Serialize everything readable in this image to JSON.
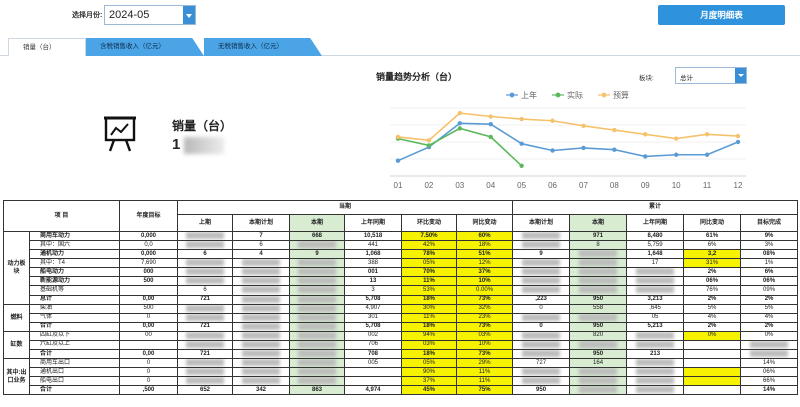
{
  "header": {
    "month_label": "选择月份:",
    "month_value": "2024-05",
    "detail_button": "月度明细表"
  },
  "tabs": [
    "销量（台）",
    "含税销售收入（亿元）",
    "无税销售收入（亿元）"
  ],
  "kpi": {
    "label": "销量（台）",
    "value": "1"
  },
  "chart_header": {
    "title": "销量趋势分析（台）",
    "board_label": "板块:",
    "board_value": "总计"
  },
  "chart_data": {
    "type": "line",
    "categories": [
      "01",
      "02",
      "03",
      "04",
      "05",
      "06",
      "07",
      "08",
      "09",
      "10",
      "11",
      "12"
    ],
    "series": [
      {
        "name": "上年",
        "color": "#5b9bd5",
        "values": [
          5.8,
          7.4,
          10.2,
          10.1,
          7.8,
          7.0,
          7.3,
          7.1,
          6.3,
          6.5,
          6.5,
          8.0
        ]
      },
      {
        "name": "实际",
        "color": "#5cb85c",
        "values": [
          8.4,
          7.6,
          9.6,
          8.6,
          5.2,
          null,
          null,
          null,
          null,
          null,
          null,
          null
        ]
      },
      {
        "name": "预算",
        "color": "#f5c26b",
        "values": [
          8.6,
          8.2,
          11.4,
          11.0,
          10.7,
          10.5,
          9.9,
          9.4,
          8.9,
          8.4,
          8.9,
          8.7
        ]
      }
    ],
    "xlabel": "",
    "ylabel": "",
    "legend_position": "top-center",
    "grid": "horizontal"
  },
  "table": {
    "headers": {
      "item": "项   目",
      "annual_target": "年度目标",
      "current_group": "当期",
      "cumulative_group": "累计",
      "cols": [
        "上期",
        "本期计划",
        "本期",
        "上年同期",
        "环比变动",
        "同比变动",
        "本期计划",
        "本期",
        "上年同期",
        "同比变动",
        "目标完成"
      ]
    },
    "categories": [
      "动力板块",
      "燃料",
      "缸数",
      "其中:出口业务"
    ],
    "rows": [
      {
        "name": "商用车动力",
        "target": "0,000",
        "c": [
          "",
          "7",
          "668",
          "10,518",
          "7.50%",
          "60%",
          "",
          "971",
          "8,480",
          "61%",
          "9%"
        ]
      },
      {
        "name": "其中：国六",
        "target": "0,0",
        "c": [
          "",
          "6",
          "",
          "441",
          "42%",
          "18%",
          "",
          "8",
          "5,759",
          "6%",
          "3%"
        ]
      },
      {
        "name": "通机动力",
        "target": "0,000",
        "c": [
          "6",
          "4",
          "9",
          "1,068",
          "78%",
          "51%",
          "9",
          "",
          "1,648",
          "3,2",
          "08%"
        ]
      },
      {
        "name": "其中：T4",
        "target": "7,690",
        "c": [
          "",
          "",
          "",
          "388",
          "05%",
          "12%",
          "",
          "",
          "17",
          "31%",
          "1%"
        ]
      },
      {
        "name": "船电动力",
        "target": "000",
        "c": [
          "",
          "",
          "",
          "001",
          "70%",
          "37%",
          "",
          "",
          "",
          "2%",
          "6%"
        ]
      },
      {
        "name": "新能源动力",
        "target": "500",
        "c": [
          "",
          "",
          "",
          "13",
          "11%",
          "10%",
          "",
          "",
          "",
          "06%",
          "06%"
        ]
      },
      {
        "name": "基础机等",
        "target": "",
        "c": [
          "6",
          "",
          "",
          "3",
          "53%",
          "0.00%",
          "",
          "",
          "",
          "76%",
          "09%"
        ]
      },
      {
        "name": "总计",
        "target": "0,00",
        "c": [
          "721",
          "",
          "",
          "5,708",
          "18%",
          "73%",
          ",223",
          "950",
          "3,213",
          "2%",
          "2%"
        ]
      },
      {
        "name": "柴油",
        "target": "500",
        "c": [
          "",
          "",
          "",
          "4,907",
          "30%",
          "32%",
          "0",
          "558",
          ",645",
          "5%",
          "5%"
        ]
      },
      {
        "name": "气体",
        "target": "0",
        "c": [
          "",
          "",
          "",
          "301",
          "11%",
          "23%",
          "",
          "",
          "05",
          "4%",
          "4%"
        ]
      },
      {
        "name": "合计",
        "target": "0,00",
        "c": [
          "721",
          "",
          "",
          "5,708",
          "18%",
          "73%",
          "0",
          "950",
          "5,213",
          "2%",
          "2%"
        ]
      },
      {
        "name": "四缸及以下",
        "target": "00",
        "c": [
          "",
          "",
          "",
          "002",
          "94%",
          "03%",
          "",
          "820",
          "",
          "0%",
          "0%"
        ]
      },
      {
        "name": "六缸及以上",
        "target": "",
        "c": [
          "",
          "",
          "",
          "706",
          "03%",
          "10%",
          "",
          "",
          "",
          "",
          ""
        ]
      },
      {
        "name": "合计",
        "target": "0,00",
        "c": [
          "721",
          "",
          "",
          "708",
          "18%",
          "73%",
          "",
          "950",
          "213",
          "",
          ""
        ]
      },
      {
        "name": "商用车出口",
        "target": "0",
        "c": [
          "",
          "",
          "",
          "005",
          "05%",
          "29%",
          "727",
          "164",
          "",
          "",
          "14%"
        ]
      },
      {
        "name": "通机出口",
        "target": "0",
        "c": [
          "",
          "",
          "",
          "",
          "90%",
          "11%",
          "",
          "",
          "",
          "",
          "06%"
        ]
      },
      {
        "name": "船电出口",
        "target": "0",
        "c": [
          "",
          "",
          "",
          "",
          "37%",
          "11%",
          "",
          "",
          "",
          "",
          "66%"
        ]
      },
      {
        "name": "合计",
        "target": ",500",
        "c": [
          "652",
          "342",
          "863",
          "4,974",
          "45%",
          "75%",
          "950",
          "",
          "",
          "",
          "14%"
        ]
      }
    ]
  },
  "colors": {
    "accent": "#2e93dc",
    "highlight": "#f6f200",
    "column_green": "#d8ecd2"
  }
}
